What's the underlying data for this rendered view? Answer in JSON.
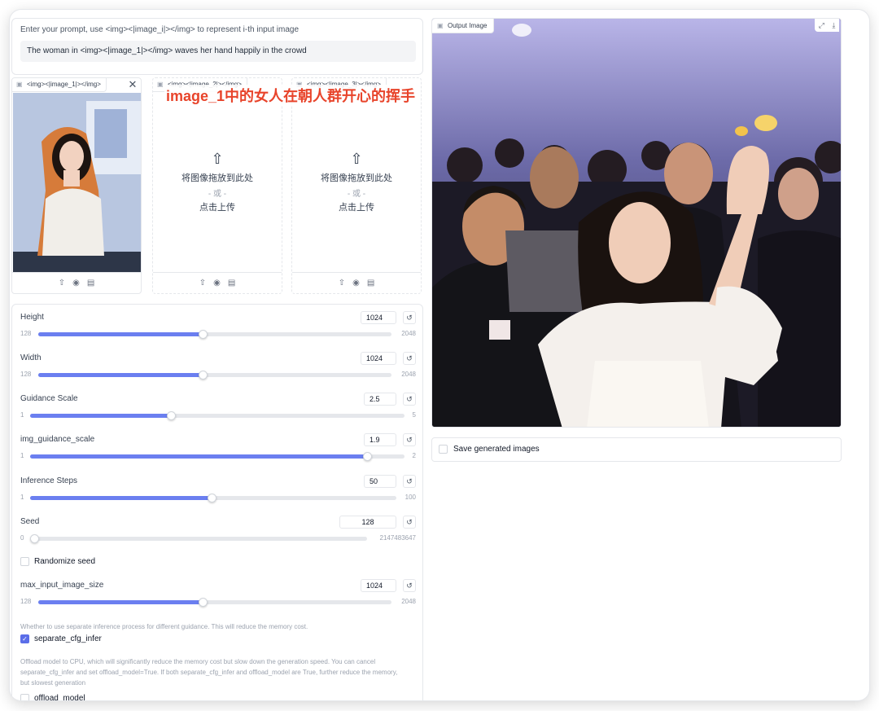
{
  "prompt": {
    "label": "Enter your prompt, use <img><|image_i|></img> to represent i-th input image",
    "value": "The woman in <img><|image_1|></img> waves her hand happily in the crowd"
  },
  "overlay_caption": "image_1中的女人在朝人群开心的挥手",
  "image_slots": [
    {
      "label": "<img><|image_1|></img>",
      "has_image": true
    },
    {
      "label": "<img><|image_2|></img>",
      "has_image": false
    },
    {
      "label": "<img><|image_3|></img>",
      "has_image": false
    }
  ],
  "upload": {
    "drop_text": "将图像拖放到此处",
    "or_text": "- 或 -",
    "click_text": "点击上传"
  },
  "icons": {
    "upload": "upload-icon",
    "webcam": "webcam-icon",
    "clipboard": "clipboard-icon",
    "reset": "reset-icon",
    "image": "image-icon",
    "fullscreen": "fullscreen-icon",
    "download": "download-icon",
    "close": "close-icon"
  },
  "settings": {
    "height": {
      "label": "Height",
      "value": "1024",
      "min": "128",
      "max": "2048",
      "fraction": 0.465
    },
    "width": {
      "label": "Width",
      "value": "1024",
      "min": "128",
      "max": "2048",
      "fraction": 0.465
    },
    "guidance_scale": {
      "label": "Guidance Scale",
      "value": "2.5",
      "min": "1",
      "max": "5",
      "fraction": 0.375
    },
    "img_guidance_scale": {
      "label": "img_guidance_scale",
      "value": "1.9",
      "min": "1",
      "max": "2",
      "fraction": 0.9
    },
    "inference_steps": {
      "label": "Inference Steps",
      "value": "50",
      "min": "1",
      "max": "100",
      "fraction": 0.495
    },
    "seed": {
      "label": "Seed",
      "value": "128",
      "min": "0",
      "max": "2147483647",
      "fraction": 0.0
    },
    "randomize_seed": {
      "label": "Randomize seed",
      "checked": false
    },
    "max_input_image_size": {
      "label": "max_input_image_size",
      "value": "1024",
      "min": "128",
      "max": "2048",
      "fraction": 0.465
    },
    "separate_cfg_info": "Whether to use separate inference process for different guidance. This will reduce the memory cost.",
    "separate_cfg_infer": {
      "label": "separate_cfg_infer",
      "checked": true
    },
    "offload_info": "Offload model to CPU, which will significantly reduce the memory cost but slow down the generation speed. You can cancel separate_cfg_infer and set offload_model=True. If both separate_cfg_infer and offload_model are True, further reduce the memory, but slowest generation",
    "offload_model": {
      "label": "offload_model",
      "checked": false
    }
  },
  "output": {
    "label": "Output Image"
  },
  "save_generated": {
    "label": "Save generated images",
    "checked": false
  },
  "colors": {
    "accent": "#6b7ff0",
    "overlay_text": "#e8442b"
  }
}
